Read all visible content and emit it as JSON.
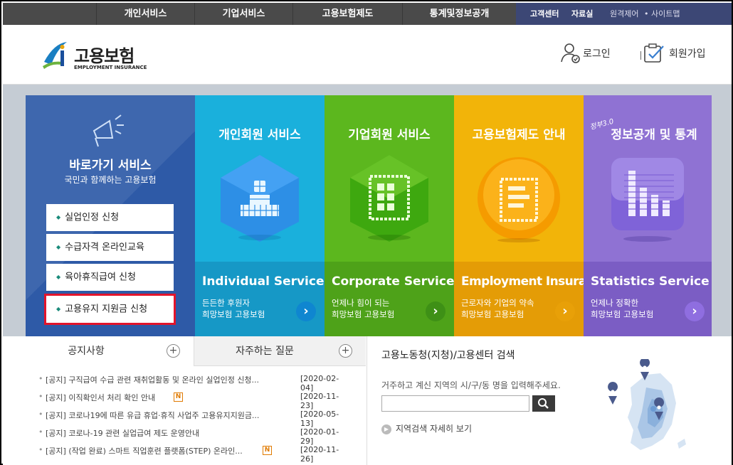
{
  "gnb": {
    "items": [
      "개인서비스",
      "기업서비스",
      "고용보험제도",
      "통계및정보공개"
    ],
    "util": [
      "고객센터",
      "자료실",
      "원격제어",
      "사이트맵"
    ]
  },
  "header": {
    "logo_ko": "고용보험",
    "logo_en": "EMPLOYMENT INSURANCE",
    "login": "로그인",
    "join": "회원가입"
  },
  "quick": {
    "title": "바로가기 서비스",
    "subtitle": "국민과 함께하는 고용보험",
    "items": [
      "실업인정 신청",
      "수급자격 온라인교육",
      "육아휴직급여 신청",
      "고용유지 지원금 신청"
    ]
  },
  "panels": [
    {
      "title": "개인회원 서비스",
      "en": "Individual Service",
      "desc1": "든든한 후원자",
      "desc2": "희망보험 고용보험",
      "icon": "person-icon",
      "color_top": "#1ab0dc",
      "color_bottom": "#1698c6"
    },
    {
      "title": "기업회원 서비스",
      "en": "Corporate Service",
      "desc1": "언제나 힘이 되는",
      "desc2": "희망보험 고용보험",
      "icon": "building-icon",
      "color_top": "#5cb71e",
      "color_bottom": "#4ea219"
    },
    {
      "title": "고용보험제도 안내",
      "en": "Employment Insurance",
      "desc1": "근로자와 기업의 약속",
      "desc2": "희망보험 고용보험",
      "icon": "document-icon",
      "color_top": "#f2b409",
      "color_bottom": "#e49c06"
    },
    {
      "title": "정보공개 및 통계",
      "badge": "정부3.0",
      "en": "Statistics Service",
      "desc1": "언제나 정확한",
      "desc2": "희망보험 고용보험",
      "icon": "bar-chart-icon",
      "color_top": "#8f72d3",
      "color_bottom": "#7b5dc4"
    }
  ],
  "tabs": {
    "notice": "공지사항",
    "faq": "자주하는 질문"
  },
  "notices": [
    {
      "text": "[공지] 구직급여 수급 관련 재취업활동 및 온라인 실업인정 신청...",
      "date": "[2020-02-04]",
      "new": false
    },
    {
      "text": "[공지] 이직확인서 처리 확인 안내",
      "date": "[2020-11-23]",
      "new": true,
      "badge": "N"
    },
    {
      "text": "[공지] 코로나19에 따른 유급 휴업·휴직 사업주 고용유지지원금...",
      "date": "[2020-05-13]",
      "new": false
    },
    {
      "text": "[공지] 코로나-19 관련 실업급여 제도 운영안내",
      "date": "[2020-01-29]",
      "new": false
    },
    {
      "text": "[공지] (작업 완료) 스마트 직업훈련 플랫폼(STEP) 온라인...",
      "date": "[2020-11-26]",
      "new": true,
      "badge": "N"
    }
  ],
  "search": {
    "title": "고용노동청(지청)/고용센터 검색",
    "desc": "거주하고 계신 지역의 시/구/동 명을 입력해주세요.",
    "placeholder": "",
    "more": "지역검색 자세히 보기"
  }
}
